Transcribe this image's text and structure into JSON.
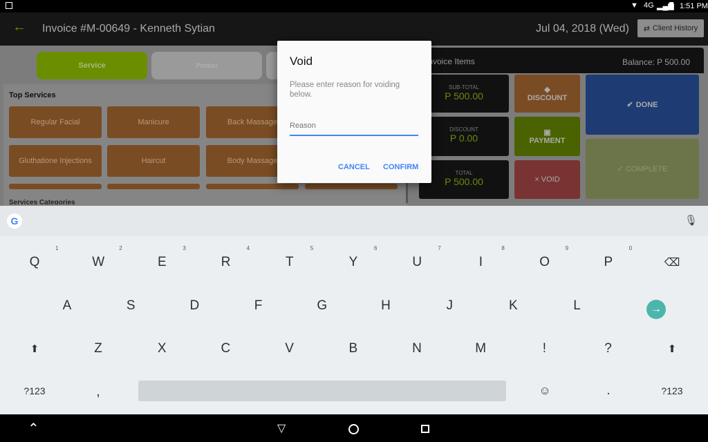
{
  "status": {
    "network": "4G",
    "time": "1:51 PM"
  },
  "appbar": {
    "title": "Invoice #M-00649 - Kenneth Sytian",
    "date": "Jul 04, 2018 (Wed)",
    "client_history": "Client History"
  },
  "tabs": [
    "Service",
    "Product"
  ],
  "top_services_label": "Top Services",
  "services": [
    "Regular Facial",
    "Manicure",
    "Back Massage",
    "Gluthatione Injections",
    "Haircut",
    "Body Massage"
  ],
  "categories_label": "Services Categories",
  "invoice": {
    "title": "Invoice Items",
    "balance": "Balance: P 500.00",
    "subtotal_label": "SUB-TOTAL",
    "subtotal": "P 500.00",
    "discount_label": "DISCOUNT",
    "discount": "P 0.00",
    "total_label": "TOTAL",
    "total": "P 500.00"
  },
  "actions": {
    "discount": "DISCOUNT",
    "payment": "PAYMENT",
    "void": "× VOID",
    "done": "DONE",
    "complete": "✓ COMPLETE"
  },
  "dialog": {
    "title": "Void",
    "message": "Please enter reason for voiding below.",
    "placeholder": "Reason",
    "value": "",
    "cancel": "CANCEL",
    "confirm": "CONFIRM"
  },
  "keyboard": {
    "row1": [
      "Q",
      "W",
      "E",
      "R",
      "T",
      "Y",
      "U",
      "I",
      "O",
      "P"
    ],
    "hints": [
      "1",
      "2",
      "3",
      "4",
      "5",
      "6",
      "7",
      "8",
      "9",
      "0"
    ],
    "row2": [
      "A",
      "S",
      "D",
      "F",
      "G",
      "H",
      "J",
      "K",
      "L"
    ],
    "row3": [
      "Z",
      "X",
      "C",
      "V",
      "B",
      "N",
      "M",
      "!",
      "?"
    ],
    "symbols": "?123",
    "comma": ",",
    "period": "."
  },
  "colors": {
    "accent": "#4285f4",
    "service_tab": "#6b8e00",
    "enter_key": "#4db6ac"
  }
}
